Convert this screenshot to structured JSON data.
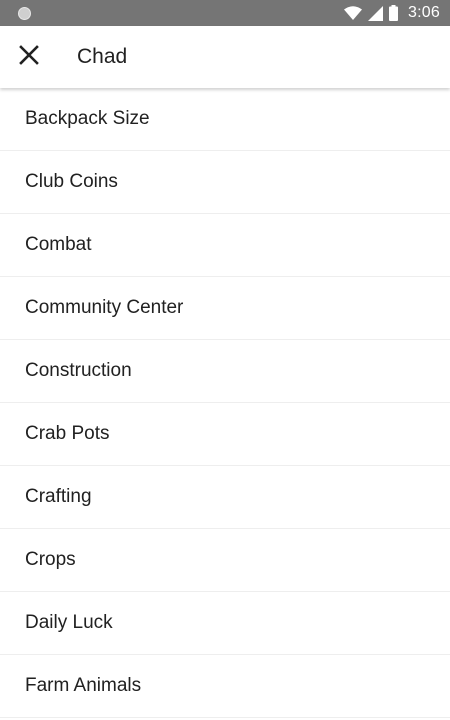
{
  "status_bar": {
    "time": "3:06",
    "icons": [
      "notification-dot-icon",
      "wifi-icon",
      "cell-signal-icon",
      "battery-icon"
    ]
  },
  "app_bar": {
    "close_icon": "close-icon",
    "title": "Chad"
  },
  "list": {
    "items": [
      {
        "label": "Backpack Size"
      },
      {
        "label": "Club Coins"
      },
      {
        "label": "Combat"
      },
      {
        "label": "Community Center"
      },
      {
        "label": "Construction"
      },
      {
        "label": "Crab Pots"
      },
      {
        "label": "Crafting"
      },
      {
        "label": "Crops"
      },
      {
        "label": "Daily Luck"
      },
      {
        "label": "Farm Animals"
      }
    ]
  },
  "colors": {
    "status_bar_bg": "#757575",
    "app_bar_bg": "#ffffff",
    "text_primary": "#212121",
    "divider": "#eeeeee"
  }
}
